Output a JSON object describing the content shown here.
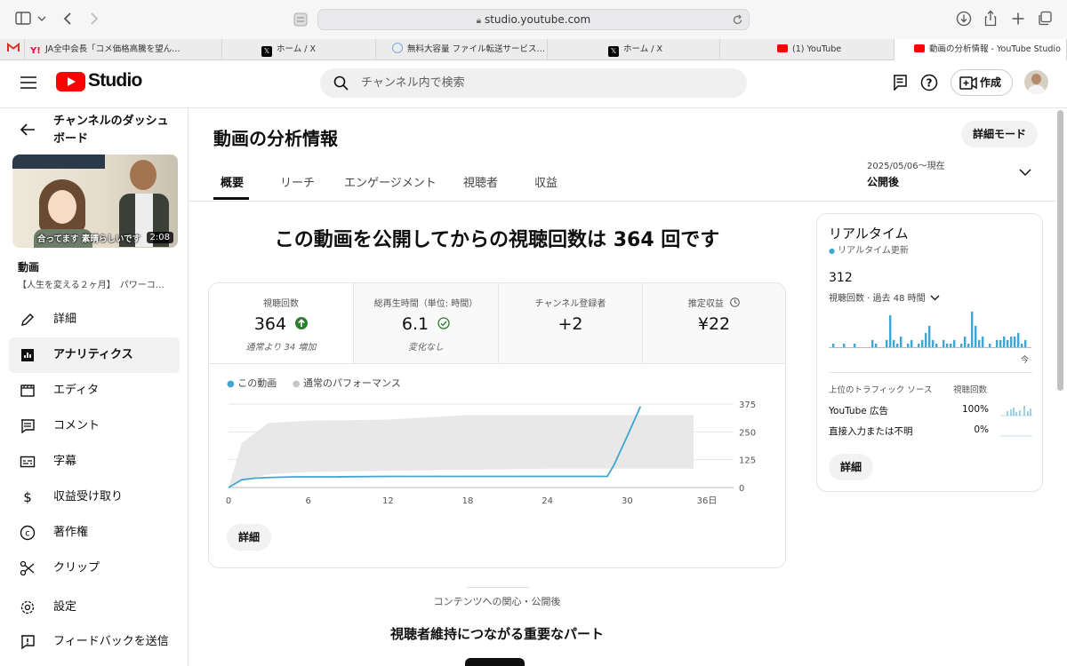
{
  "browser": {
    "url": "studio.youtube.com",
    "tabs": [
      {
        "label": "JA全中会長「コメ価格高騰を望ん…",
        "fav": "yahoo-favicon",
        "color": "#ff0033"
      },
      {
        "label": "ホーム / X",
        "fav": "x-favicon",
        "color": "#000000"
      },
      {
        "label": "無料大容量 ファイル転送サービス…",
        "fav": "transfer-favicon",
        "color": "#7fa7d8"
      },
      {
        "label": "ホーム / X",
        "fav": "x-favicon",
        "color": "#000000"
      },
      {
        "label": "(1) YouTube",
        "fav": "youtube-favicon",
        "color": "#ff0000"
      },
      {
        "label": "動画の分析情報 - YouTube Studio",
        "fav": "youtube-favicon",
        "color": "#ff0000"
      }
    ]
  },
  "header": {
    "logo_text": "Studio",
    "search_placeholder": "チャンネル内で検索",
    "create_label": "作成"
  },
  "sidebar": {
    "back_label": "チャンネルのダッシュボード",
    "duration": "2:08",
    "thumb_caption": "合ってます 素晴らしいです",
    "video_label": "動画",
    "video_title": "【人生を変える２ヶ月】　パワーコ…",
    "items": [
      {
        "label": "詳細",
        "icon": "pencil-icon",
        "active": false
      },
      {
        "label": "アナリティクス",
        "icon": "analytics-icon",
        "active": true
      },
      {
        "label": "エディタ",
        "icon": "editor-icon",
        "active": false
      },
      {
        "label": "コメント",
        "icon": "comment-icon",
        "active": false
      },
      {
        "label": "字幕",
        "icon": "subtitles-icon",
        "active": false
      },
      {
        "label": "収益受け取り",
        "icon": "dollar-icon",
        "active": false
      },
      {
        "label": "著作権",
        "icon": "copyright-icon",
        "active": false
      },
      {
        "label": "クリップ",
        "icon": "scissors-icon",
        "active": false
      },
      {
        "label": "設定",
        "icon": "gear-icon",
        "active": false
      },
      {
        "label": "フィードバックを送信",
        "icon": "feedback-icon",
        "active": false
      }
    ]
  },
  "main": {
    "title": "動画の分析情報",
    "advanced_mode": "詳細モード",
    "tabs": [
      "概要",
      "リーチ",
      "エンゲージメント",
      "視聴者",
      "収益"
    ],
    "date_range": "2025/05/06〜現在",
    "date_label": "公開後",
    "headline": "この動画を公開してからの視聴回数は 364 回です",
    "kpis": [
      {
        "label": "視聴回数",
        "value": "364",
        "sub": "通常より 34 増加",
        "status": "up-arrow-icon"
      },
      {
        "label": "総再生時間（単位: 時間）",
        "value": "6.1",
        "sub": "変化なし",
        "status": "check-icon"
      },
      {
        "label": "チャンネル登録者",
        "value": "+2",
        "sub": ""
      },
      {
        "label": "推定収益",
        "value": "¥22",
        "sub": "",
        "status": "clock-icon"
      }
    ],
    "legend": {
      "this_video": "この動画",
      "typical": "通常のパフォーマンス"
    },
    "details_label": "詳細",
    "section_caption": "コンテンツへの関心・公開後",
    "section_title": "視聴者維持につながる重要なパート"
  },
  "chart_data": {
    "type": "line",
    "x_tick_labels": [
      "0",
      "6",
      "12",
      "18",
      "24",
      "30",
      "36日"
    ],
    "y_tick_labels": [
      "375",
      "250",
      "125",
      "0"
    ],
    "ylim": [
      0,
      375
    ],
    "xlim": [
      0,
      36
    ],
    "series": [
      {
        "name": "この動画",
        "color": "#3ea6d1",
        "x": [
          0,
          1,
          2,
          3,
          5,
          8,
          12,
          16,
          20,
          24,
          27,
          28.5,
          29,
          30,
          31
        ],
        "y": [
          0,
          35,
          42,
          45,
          48,
          48,
          50,
          50,
          50,
          50,
          50,
          50,
          100,
          230,
          364
        ]
      },
      {
        "name": "通常のパフォーマンス",
        "type": "band",
        "color": "#e8e8e8",
        "x": [
          0,
          1,
          3,
          6,
          12,
          18,
          24,
          30,
          35
        ],
        "upper": [
          0,
          200,
          290,
          300,
          305,
          325,
          325,
          325,
          325
        ],
        "lower": [
          0,
          30,
          60,
          70,
          75,
          80,
          85,
          85,
          85
        ]
      }
    ],
    "grid": true
  },
  "realtime": {
    "title": "リアルタイム",
    "update_label": "リアルタイム更新",
    "views": "312",
    "views_label": "視聴回数 · 過去 48 時間",
    "now_label": "今",
    "bars": [
      0,
      1,
      0,
      0,
      1,
      0,
      0,
      1,
      0,
      0,
      0,
      0,
      2,
      1,
      0,
      0,
      2,
      9,
      2,
      1,
      3,
      0,
      1,
      2,
      0,
      1,
      2,
      4,
      6,
      2,
      1,
      0,
      2,
      1,
      1,
      2,
      0,
      1,
      3,
      1,
      10,
      6,
      2,
      3,
      0,
      1,
      0,
      2,
      2,
      3,
      2,
      3,
      3,
      4,
      1,
      2,
      0
    ],
    "traffic_header": "上位のトラフィック ソース",
    "traffic_views_header": "視聴回数",
    "sources": [
      {
        "label": "YouTube 広告",
        "value": "100%"
      },
      {
        "label": "直接入力または不明",
        "value": "0%"
      }
    ],
    "details_label": "詳細"
  }
}
